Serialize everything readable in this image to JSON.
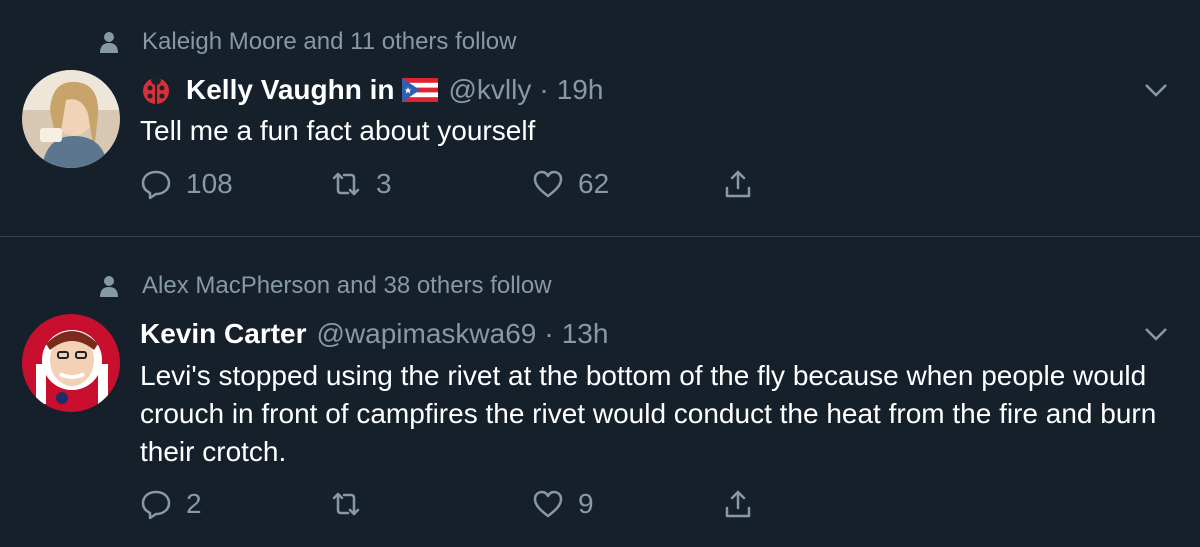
{
  "tweets": [
    {
      "social_context": "Kaleigh Moore and 11 others follow",
      "name": "Kelly Vaughn in",
      "handle": "@kvlly",
      "separator": "·",
      "time": "19h",
      "text": "Tell me a fun fact about yourself",
      "replies": "108",
      "retweets": "3",
      "likes": "62"
    },
    {
      "social_context": "Alex MacPherson and 38 others follow",
      "name": "Kevin Carter",
      "handle": "@wapimaskwa69",
      "separator": "·",
      "time": "13h",
      "text": "Levi's stopped using the rivet at the bottom of the fly because when people would crouch in front of campfires the rivet would conduct the heat from the fire and burn their crotch.",
      "replies": "2",
      "retweets": "",
      "likes": "9"
    }
  ],
  "colors": {
    "background": "#15202b",
    "secondary_text": "#8899a6",
    "divider": "#38444d"
  },
  "icons": [
    "person-icon",
    "ladybug-icon",
    "puerto-rico-flag-icon",
    "chevron-down-icon",
    "reply-icon",
    "retweet-icon",
    "like-icon",
    "share-icon"
  ]
}
